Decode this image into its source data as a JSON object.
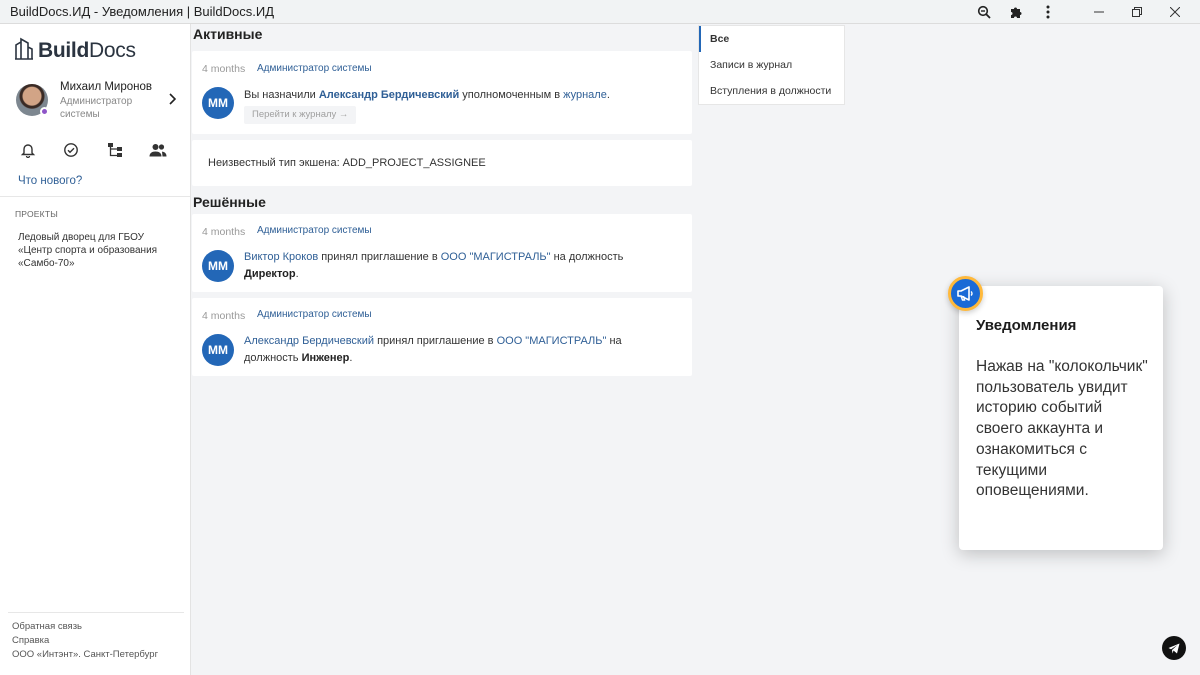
{
  "window": {
    "title": "BuildDocs.ИД - Уведомления | BuildDocs.ИД",
    "icons": [
      "zoom-out-icon",
      "puzzle-icon",
      "kebab-menu-icon",
      "minimize-icon",
      "restore-icon",
      "close-icon"
    ]
  },
  "sidebar": {
    "logo_bold": "Build",
    "logo_rest": "Docs",
    "user": {
      "name": "Михаил Миронов",
      "role": "Администратор системы"
    },
    "nav_icons": [
      "bell-icon",
      "check-circle-icon",
      "org-chart-icon",
      "people-icon"
    ],
    "whats_new": "Что нового?",
    "projects_heading": "ПРОЕКТЫ",
    "projects": [
      "Ледовый дворец для ГБОУ «Центр спорта и образования «Самбо-70»"
    ],
    "footer": {
      "feedback": "Обратная связь",
      "help": "Справка",
      "company": "ООО «Интэнт». Санкт-Петербург"
    }
  },
  "main": {
    "active_title": "Активные",
    "resolved_title": "Решённые",
    "notifications_active": [
      {
        "time": "4 months",
        "sender": "Администратор системы",
        "avatar": "ММ",
        "text_1": "Вы назначили ",
        "person": "Александр Бердичевский",
        "text_2": " уполномоченным в ",
        "link": "журнале",
        "text_3": ".",
        "action": "Перейти к журналу →"
      }
    ],
    "unknown_action": "Неизвестный тип экшена: ADD_PROJECT_ASSIGNEE",
    "notifications_resolved": [
      {
        "time": "4 months",
        "sender": "Администратор системы",
        "avatar": "ММ",
        "person": "Виктор Кроков",
        "text_1": " принял приглашение в ",
        "org": "ООО \"МАГИСТРАЛЬ\"",
        "text_2": " на должность ",
        "position": "Директор",
        "text_3": "."
      },
      {
        "time": "4 months",
        "sender": "Администратор системы",
        "avatar": "ММ",
        "person": "Александр Бердичевский",
        "text_1": " принял приглашение в ",
        "org": "ООО \"МАГИСТРАЛЬ\"",
        "text_2": " на должность ",
        "position": "Инженер",
        "text_3": "."
      }
    ],
    "filters": [
      "Все",
      "Записи в журнал",
      "Вступления в должности"
    ],
    "active_filter": "Все"
  },
  "tooltip": {
    "title": "Уведомления",
    "body": "Нажав на \"колокольчик\" пользователь увидит историю событий своего аккаунта и ознакомиться с текущими оповещениями.",
    "badge_icon": "megaphone-icon"
  },
  "colors": {
    "accent": "#2367b7",
    "link": "#2f5f96",
    "badge_ring": "#ffb93b",
    "background": "#f3f4f6"
  }
}
